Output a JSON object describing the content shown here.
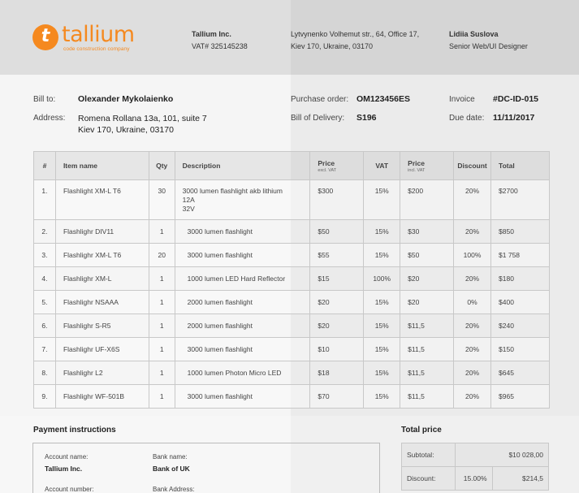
{
  "company": {
    "logo_letter": "t",
    "name": "tallium",
    "tagline": "code construction company",
    "legal_name": "Tallium Inc.",
    "vat": "VAT# 325145238",
    "address_line1": "Lytvynenko Volhemut str., 64, Office 17,",
    "address_line2": "Kiev 170, Ukraine, 03170",
    "contact_name": "Lidiia Suslova",
    "contact_role": "Senior Web/UI Designer",
    "brand_color": "#f5891f"
  },
  "bill": {
    "bill_to_label": "Bill to:",
    "bill_to_name": "Olexander Mykolaienko",
    "address_label": "Address:",
    "address_line1": "Romena Rollana 13a, 101, suite 7",
    "address_line2": "Kiev 170, Ukraine, 03170"
  },
  "order": {
    "po_label": "Purchase order:",
    "po_value": "OM123456ES",
    "delivery_label": "Bill of Delivery:",
    "delivery_value": "S196",
    "invoice_label": "Invoice",
    "invoice_value": "#DC-ID-015",
    "due_label": "Due date:",
    "due_value": "11/11/2017"
  },
  "table": {
    "headers": {
      "num": "#",
      "item": "Item name",
      "qty": "Qty",
      "desc": "Description",
      "price": "Price",
      "price_sub": "excl. VAT",
      "vat": "VAT",
      "price_incl": "Price",
      "price_incl_sub": "incl. VAT",
      "discount": "Discount",
      "total": "Total"
    },
    "rows": [
      {
        "num": "1.",
        "item": "Flashlight XM-L T6",
        "qty": "30",
        "desc": [
          "3000 lumen flashlight akb lithium",
          "12A",
          "32V"
        ],
        "price": "$300",
        "vat": "15%",
        "price_incl": "$200",
        "discount": "20%",
        "total": "$2700"
      },
      {
        "num": "2.",
        "item": "Flashlighr DIV11",
        "qty": "1",
        "desc": [
          "3000 lumen flashlight"
        ],
        "price": "$50",
        "vat": "15%",
        "price_incl": "$30",
        "discount": "20%",
        "total": "$850"
      },
      {
        "num": "3.",
        "item": "Flashlighr XM-L T6",
        "qty": "20",
        "desc": [
          "3000 lumen flashlight"
        ],
        "price": "$55",
        "vat": "15%",
        "price_incl": "$50",
        "discount": "100%",
        "total": "$1 758"
      },
      {
        "num": "4.",
        "item": "Flashlighr XM-L",
        "qty": "1",
        "desc": [
          "1000 lumen LED Hard Reflector"
        ],
        "price": "$15",
        "vat": "100%",
        "price_incl": "$20",
        "discount": "20%",
        "total": "$180"
      },
      {
        "num": "5.",
        "item": "Flashlighr NSAAA",
        "qty": "1",
        "desc": [
          "2000 lumen flashlight"
        ],
        "price": "$20",
        "vat": "15%",
        "price_incl": "$20",
        "discount": "0%",
        "total": "$400"
      },
      {
        "num": "6.",
        "item": "Flashlighr S-R5",
        "qty": "1",
        "desc": [
          "2000 lumen flashlight"
        ],
        "price": "$20",
        "vat": "15%",
        "price_incl": "$11,5",
        "discount": "20%",
        "total": "$240"
      },
      {
        "num": "7.",
        "item": "Flashlighr UF-X6S",
        "qty": "1",
        "desc": [
          "3000 lumen flashlight"
        ],
        "price": "$10",
        "vat": "15%",
        "price_incl": "$11,5",
        "discount": "20%",
        "total": "$150"
      },
      {
        "num": "8.",
        "item": "Flashlighr L2",
        "qty": "1",
        "desc": [
          "1000 lumen Photon Micro LED"
        ],
        "price": "$18",
        "vat": "15%",
        "price_incl": "$11,5",
        "discount": "20%",
        "total": "$645"
      },
      {
        "num": "9.",
        "item": "Flashlighr WF-501B",
        "qty": "1",
        "desc": [
          "3000 lumen flashlight"
        ],
        "price": "$70",
        "vat": "15%",
        "price_incl": "$11,5",
        "discount": "20%",
        "total": "$965"
      }
    ]
  },
  "payment": {
    "title": "Payment instructions",
    "account_name_label": "Account name:",
    "account_name_value": "Tallium Inc.",
    "bank_name_label": "Bank name:",
    "bank_name_value": "Bank of UK",
    "account_number_label": "Account number:",
    "bank_address_label": "Bank Address:"
  },
  "totals": {
    "title": "Total price",
    "subtotal_label": "Subtotal:",
    "subtotal_value": "$10 028,00",
    "discount_label": "Discount:",
    "discount_pct": "15.00%",
    "discount_value": "$214,5"
  }
}
